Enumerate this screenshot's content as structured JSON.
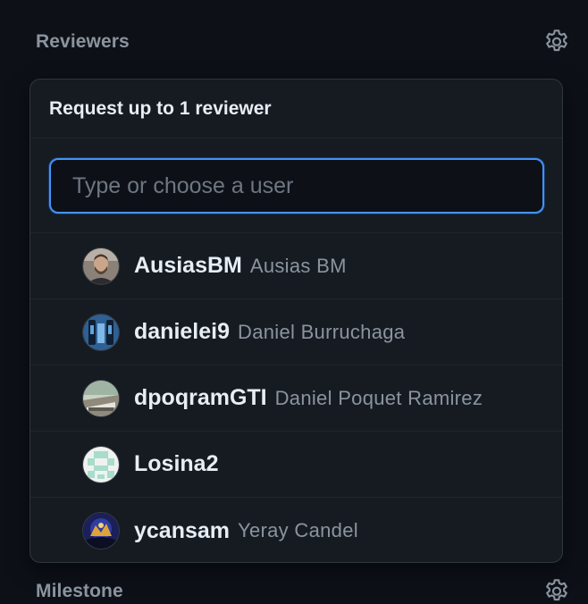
{
  "reviewers_section": {
    "title": "Reviewers",
    "settings_icon": "gear-icon"
  },
  "popover": {
    "title": "Request up to 1 reviewer",
    "filter": {
      "placeholder": "Type or choose a user",
      "value": ""
    },
    "users": [
      {
        "login": "AusiasBM",
        "name": "Ausias BM"
      },
      {
        "login": "danielei9",
        "name": "Daniel Burruchaga"
      },
      {
        "login": "dpoqramGTI",
        "name": "Daniel Poquet Ramirez"
      },
      {
        "login": "Losina2",
        "name": ""
      },
      {
        "login": "ycansam",
        "name": "Yeray Candel"
      }
    ]
  },
  "milestone_section": {
    "title": "Milestone",
    "settings_icon": "gear-icon"
  },
  "colors": {
    "background": "#0d1117",
    "panel": "#161b22",
    "border": "#30363d",
    "focus_accent": "#4493f8",
    "muted_text": "#8b949e"
  }
}
